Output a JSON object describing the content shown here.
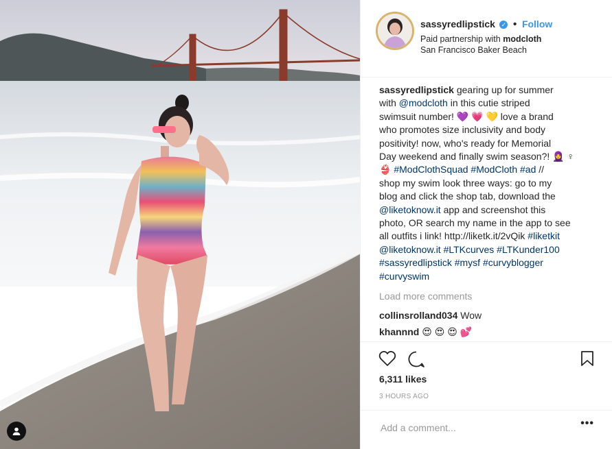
{
  "post": {
    "username": "sassyredlipstick",
    "follow_label": "Follow",
    "partnership_prefix": "Paid partnership with ",
    "partner": "modcloth",
    "location": "San Francisco Baker Beach",
    "caption": {
      "username": "sassyredlipstick",
      "l1": " gearing up for summer",
      "l2a": "with ",
      "mention_modcloth": "@modcloth",
      "l2b": " in this cutie striped",
      "l3": "swimsuit number! 💜 💗 💛  love a brand",
      "l4": "who promotes size inclusivity and body",
      "l5": "positivity! now, who's ready for Memorial",
      "l6": "Day weekend and finally swim season?! 🧕 ♀",
      "l7a": "👙  ",
      "tag_squad": "#ModClothSquad",
      "tag_modcloth": "#ModCloth",
      "tag_ad": "#ad",
      "l7b": " //",
      "l8": "shop my swim look three ways: go to my",
      "l9": "blog and click the shop tab, download the",
      "mention_liketoknow": "@liketoknow.it",
      "l10b": " app and screenshot this",
      "l11": "photo, OR search my name in the app to see",
      "l12a": "all outfits i link! http://liketk.it/2vQik ",
      "tag_liketkit": "#liketkit",
      "mention_liketoknow2": "@liketoknow.it",
      "tag_ltkcurves": "#LTKcurves",
      "tag_ltkunder": "#LTKunder100",
      "tag_sassy": "#sassyredlipstick",
      "tag_mysf": "#mysf",
      "tag_curvyblogger": "#curvyblogger",
      "tag_curvyswim": "#curvyswim"
    },
    "load_more": "Load more comments",
    "comments": [
      {
        "user": "collinsrolland034",
        "text": " Wow"
      },
      {
        "user": "khannnd",
        "text": " 😍 😍 😍 💕"
      }
    ],
    "likes": "6,311 likes",
    "time": "3 HOURS AGO",
    "add_comment_placeholder": "Add a comment...",
    "more_label": "•••"
  },
  "icons": {
    "like": "heart-icon",
    "comment": "comment-icon",
    "save": "bookmark-icon",
    "tag": "person-tag-icon",
    "verified": "verified-badge-icon"
  },
  "colors": {
    "link_blue": "#3897f0",
    "hashtag": "#003569",
    "muted": "#999999",
    "text": "#262626"
  }
}
